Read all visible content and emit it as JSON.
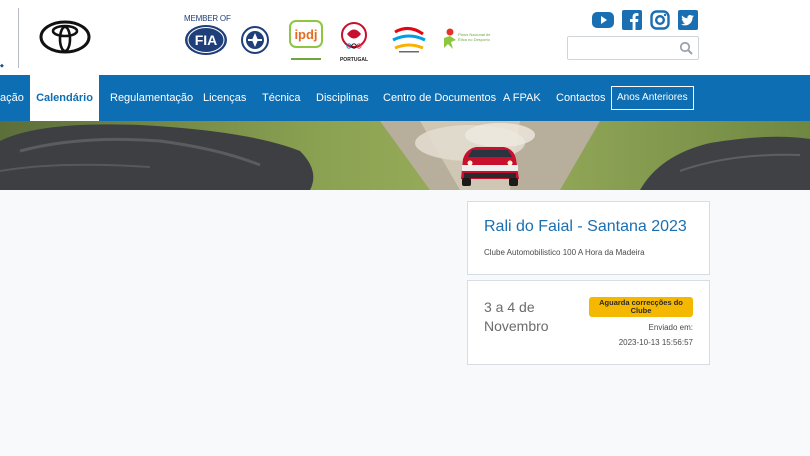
{
  "header": {
    "fia_member_label": "MEMBER OF",
    "fia_text": "FIA",
    "ipdj_text": "ipdj",
    "portugal_text": "PORTUGAL",
    "plano_text": "Plano Nacional de Ética no Desporto",
    "search": {
      "value": "",
      "placeholder": ""
    }
  },
  "nav": {
    "items": [
      {
        "label": "ação"
      },
      {
        "label": "Calendário",
        "active": true
      },
      {
        "label": "Regulamentação"
      },
      {
        "label": "Licenças"
      },
      {
        "label": "Técnica"
      },
      {
        "label": "Disciplinas"
      },
      {
        "label": "Centro de Documentos"
      },
      {
        "label": "A FPAK"
      },
      {
        "label": "Contactos"
      },
      {
        "label": "Anos Anteriores"
      }
    ]
  },
  "event": {
    "title": "Rali do Faial - Santana 2023",
    "club": "Clube Automobilistico 100 A Hora da Madeira",
    "dates": "3 a 4 de Novembro",
    "status": "Aguarda correcções do Clube",
    "sent_label": "Enviado em:",
    "sent_at": "2023-10-13 15:56:57"
  },
  "colors": {
    "nav_bg": "#0d6eb3",
    "title": "#1a6fb2",
    "badge": "#f5b800"
  }
}
